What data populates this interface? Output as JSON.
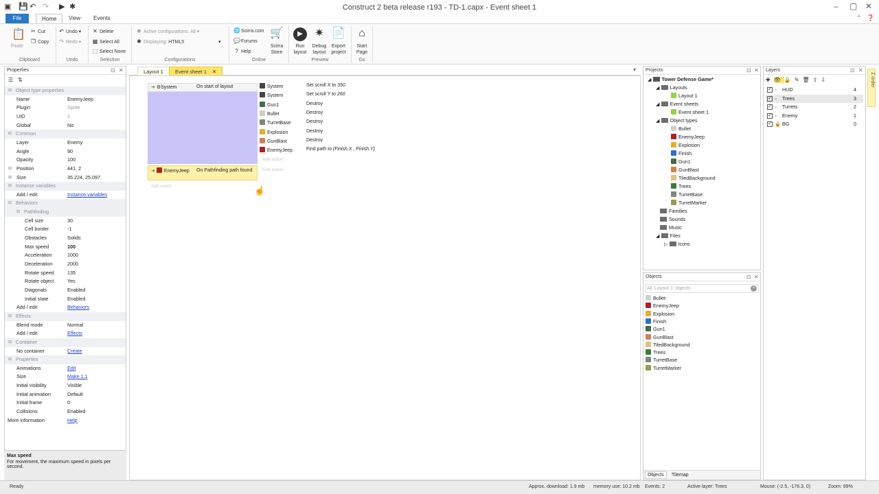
{
  "window": {
    "title": "Construct 2 beta release r193 - TD-1.capx - Event sheet 1"
  },
  "ribbon_tabs": [
    "File",
    "Home",
    "View",
    "Events"
  ],
  "ribbon": {
    "clipboard": {
      "paste": "Paste",
      "cut": "Cut",
      "copy": "Copy",
      "group": "Clipboard"
    },
    "undo": {
      "undo": "Undo",
      "redo": "Redo",
      "group": "Undo"
    },
    "selection": {
      "delete": "Delete",
      "select_all": "Select All",
      "select_none": "Select None",
      "group": "Selection"
    },
    "configurations": {
      "active": "Active configurations: All",
      "displaying": "Displaying:",
      "displaying_value": "HTML5",
      "group": "Configurations"
    },
    "online": {
      "scirra": "Scirra.com",
      "forums": "Forums",
      "help": "Help",
      "store": "Scirra Store",
      "group": "Online"
    },
    "preview": {
      "run": "Run layout",
      "debug": "Debug layout",
      "export": "Export project",
      "group": "Preview"
    },
    "go": {
      "start": "Start Page",
      "group": "Go"
    }
  },
  "properties": {
    "pane_title": "Properties",
    "rows": [
      {
        "type": "cat",
        "label": "Object type properties"
      },
      {
        "label": "Name",
        "value": "EnemyJeep"
      },
      {
        "label": "Plugin",
        "value": "Sprite",
        "gray": true
      },
      {
        "label": "UID",
        "value": "1",
        "gray": true
      },
      {
        "label": "Global",
        "value": "No"
      },
      {
        "type": "cat",
        "label": "Common"
      },
      {
        "label": "Layer",
        "value": "Enemy"
      },
      {
        "label": "Angle",
        "value": "90"
      },
      {
        "label": "Opacity",
        "value": "100"
      },
      {
        "label": "Position",
        "value": "441, 2",
        "expand": true
      },
      {
        "label": "Size",
        "value": "35.224, 25.097",
        "expand": true
      },
      {
        "type": "cat",
        "label": "Instance variables"
      },
      {
        "label": "Add / edit",
        "value": "Instance variables",
        "link": true
      },
      {
        "type": "cat",
        "label": "Behaviors"
      },
      {
        "type": "cat",
        "label": "Pathfinding",
        "sub": true
      },
      {
        "label": "Cell size",
        "value": "30",
        "sub": true
      },
      {
        "label": "Cell border",
        "value": "-1",
        "sub": true
      },
      {
        "label": "Obstacles",
        "value": "Solids",
        "sub": true
      },
      {
        "label": "Max speed",
        "value": "100",
        "sub": true,
        "selected": true
      },
      {
        "label": "Acceleration",
        "value": "1000",
        "sub": true
      },
      {
        "label": "Deceleration",
        "value": "2000",
        "sub": true
      },
      {
        "label": "Rotate speed",
        "value": "135",
        "sub": true
      },
      {
        "label": "Rotate object",
        "value": "Yes",
        "sub": true
      },
      {
        "label": "Diagonals",
        "value": "Enabled",
        "sub": true
      },
      {
        "label": "Initial state",
        "value": "Enabled",
        "sub": true
      },
      {
        "label": "Add / edit",
        "value": "Behaviors",
        "link": true
      },
      {
        "type": "cat",
        "label": "Effects"
      },
      {
        "label": "Blend mode",
        "value": "Normal"
      },
      {
        "label": "Add / edit",
        "value": "Effects",
        "link": true
      },
      {
        "type": "cat",
        "label": "Container"
      },
      {
        "label": "No container",
        "value": "Create",
        "link": true
      },
      {
        "type": "cat",
        "label": "Properties"
      },
      {
        "label": "Animations",
        "value": "Edit",
        "link": true
      },
      {
        "label": "Size",
        "value": "Make 1:1",
        "link": true
      },
      {
        "label": "Initial visibility",
        "value": "Visible"
      },
      {
        "label": "Initial animation",
        "value": "Default"
      },
      {
        "label": "Initial frame",
        "value": "0"
      },
      {
        "label": "Collisions",
        "value": "Enabled"
      },
      {
        "label": "More information",
        "value": "Help",
        "link": true,
        "top": true
      }
    ],
    "desc_title": "Max speed",
    "desc_text": "For movement, the maximum speed in pixels per second."
  },
  "doc_tabs": [
    "Layout 1",
    "Event sheet 1"
  ],
  "events": {
    "e1_object": "System",
    "e1_condition": "On start of layout",
    "actions": [
      {
        "object": "System",
        "action": "Set scroll X to ",
        "italic": "350",
        "color": "#444"
      },
      {
        "object": "System",
        "action": "Set scroll Y to ",
        "italic": "260",
        "color": "#444"
      },
      {
        "object": "Gun1",
        "action": "Destroy",
        "color": "#4a6b4a"
      },
      {
        "object": "Bullet",
        "action": "Destroy",
        "color": "#cccccc"
      },
      {
        "object": "TurretBase",
        "action": "Destroy",
        "color": "#7a8a7a"
      },
      {
        "object": "Explosion",
        "action": "Destroy",
        "color": "#e0b030"
      },
      {
        "object": "GunBlast",
        "action": "Destroy",
        "color": "#d08050"
      },
      {
        "object": "EnemyJeep",
        "action": "Find path to ",
        "italic": "(Finish.X , Finish.Y)",
        "color": "#b02020"
      }
    ],
    "add_action": "Add action",
    "e2_object": "EnemyJeep",
    "e2_condition": "On  Pathfinding path found",
    "add_event": "Add event"
  },
  "projects": {
    "pane_title": "Projects",
    "root": "Tower Defense Game*",
    "layouts_folder": "Layouts",
    "layout": "Layout 1",
    "eventsheets_folder": "Event sheets",
    "eventsheet": "Event sheet 1",
    "objecttypes_folder": "Object types",
    "object_types": [
      {
        "name": "Bullet",
        "color": "#d0d0d0"
      },
      {
        "name": "EnemyJeep",
        "color": "#b02020"
      },
      {
        "name": "Explosion",
        "color": "#e0b030"
      },
      {
        "name": "Finish",
        "color": "#2a6fd6"
      },
      {
        "name": "Gun1",
        "color": "#4a6b4a"
      },
      {
        "name": "GunBlast",
        "color": "#d08050"
      },
      {
        "name": "TiledBackground",
        "color": "#e0c080"
      },
      {
        "name": "Trees",
        "color": "#3c7a3c"
      },
      {
        "name": "TurretBase",
        "color": "#7a8a7a"
      },
      {
        "name": "TurretMarker",
        "color": "#9a9a50"
      }
    ],
    "other_folders": [
      "Families",
      "Sounds",
      "Music",
      "Files"
    ],
    "files_sub": "Icons"
  },
  "objects": {
    "pane_title": "Objects",
    "search_placeholder": "All 'Layout 1' objects",
    "items": [
      {
        "name": "Bullet",
        "color": "#d0d0d0"
      },
      {
        "name": "EnemyJeep",
        "color": "#b02020"
      },
      {
        "name": "Explosion",
        "color": "#e0b030"
      },
      {
        "name": "Finish",
        "color": "#2a6fd6"
      },
      {
        "name": "Gun1",
        "color": "#4a6b4a"
      },
      {
        "name": "GunBlast",
        "color": "#d08050"
      },
      {
        "name": "TiledBackground",
        "color": "#e0c080"
      },
      {
        "name": "Trees",
        "color": "#3c7a3c"
      },
      {
        "name": "TurretBase",
        "color": "#7a8a7a"
      },
      {
        "name": "TurretMarker",
        "color": "#9a9a50"
      }
    ],
    "tabs": [
      "Objects",
      "Tilemap"
    ]
  },
  "layers": {
    "pane_title": "Layers",
    "side_tab": "Z order",
    "items": [
      {
        "name": "HUD",
        "num": "4"
      },
      {
        "name": "Trees",
        "num": "3",
        "selected": true
      },
      {
        "name": "Turrets",
        "num": "2"
      },
      {
        "name": "Enemy",
        "num": "1"
      },
      {
        "name": "BG",
        "num": "0",
        "locked": true
      }
    ]
  },
  "status": {
    "ready": "Ready",
    "download": "Approx. download: 1.9 mb",
    "memory": "memory use: 10.2 mb",
    "events": "Events: 2",
    "active_layer": "Active layer: Trees",
    "mouse": "Mouse: (-2.5, -176.3, 0)",
    "zoom": "Zoom: 99%"
  },
  "colors": {
    "accent": "#2b78c5",
    "tab_active": "#ffe36a",
    "event_block": "#c8c4f8",
    "selected_event": "#fff1a8"
  }
}
